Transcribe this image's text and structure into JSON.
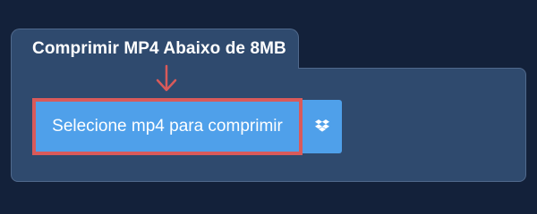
{
  "card": {
    "title": "Comprimir MP4 Abaixo de 8MB"
  },
  "upload": {
    "select_label": "Selecione mp4 para comprimir",
    "dropbox_icon": "dropbox-icon"
  },
  "colors": {
    "page_bg": "#13213a",
    "card_bg": "#2f4a6e",
    "button_bg": "#4fa0ea",
    "highlight": "#d95a5a"
  }
}
